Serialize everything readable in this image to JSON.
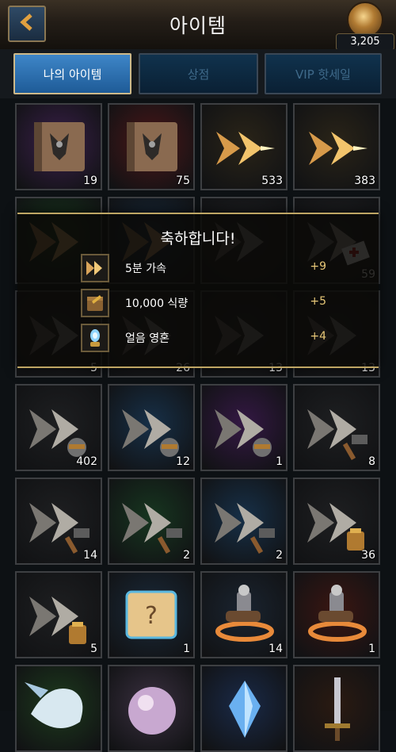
{
  "header": {
    "title": "아이템",
    "power": "3,205"
  },
  "tabs": [
    {
      "label": "나의 아이템",
      "active": true
    },
    {
      "label": "상점",
      "active": false
    },
    {
      "label": "VIP 핫세일",
      "active": false
    }
  ],
  "items": [
    {
      "icon": "dragon-tome-purple",
      "bg": "#3a1f4a",
      "count": "19"
    },
    {
      "icon": "dragon-tome-red",
      "bg": "#4a1618",
      "count": "75"
    },
    {
      "icon": "speedup-gold",
      "bg": "#2a2418",
      "count": "533"
    },
    {
      "icon": "speedup-gold",
      "bg": "#2a2418",
      "count": "383"
    },
    {
      "icon": "speedup-green",
      "bg": "#17361c",
      "count": ""
    },
    {
      "icon": "speedup-blue",
      "bg": "#16283a",
      "count": ""
    },
    {
      "icon": "speedup-dark",
      "bg": "#1e1f21",
      "count": ""
    },
    {
      "icon": "speedup-heal",
      "bg": "#1e1f21",
      "count": "59"
    },
    {
      "icon": "speedup-dark",
      "bg": "#1e1f21",
      "count": "5"
    },
    {
      "icon": "speedup-dark",
      "bg": "#1e1f21",
      "count": "26"
    },
    {
      "icon": "speedup-dark",
      "bg": "#1e1f21",
      "count": "13"
    },
    {
      "icon": "speedup-dark",
      "bg": "#1e1f21",
      "count": "13"
    },
    {
      "icon": "speedup-training",
      "bg": "#1e1f21",
      "count": "402"
    },
    {
      "icon": "speedup-training",
      "bg": "#173048",
      "count": "12"
    },
    {
      "icon": "speedup-training",
      "bg": "#341844",
      "count": "1"
    },
    {
      "icon": "speedup-building",
      "bg": "#1e1f21",
      "count": "8"
    },
    {
      "icon": "speedup-building",
      "bg": "#1e1f21",
      "count": "14"
    },
    {
      "icon": "speedup-building",
      "bg": "#173620",
      "count": "2"
    },
    {
      "icon": "speedup-building",
      "bg": "#173048",
      "count": "2"
    },
    {
      "icon": "speedup-research",
      "bg": "#1e1f21",
      "count": "36"
    },
    {
      "icon": "speedup-research",
      "bg": "#1e1f21",
      "count": "5"
    },
    {
      "icon": "mystery-scroll",
      "bg": "#1a2a3a",
      "count": "1"
    },
    {
      "icon": "cavalry-swap",
      "bg": "#1a2430",
      "count": "14"
    },
    {
      "icon": "cavalry-swap-red",
      "bg": "#3a1612",
      "count": "1"
    },
    {
      "icon": "pegasus",
      "bg": "#1d3a1d",
      "count": ""
    },
    {
      "icon": "orb",
      "bg": "#3a3040",
      "count": ""
    },
    {
      "icon": "crystal",
      "bg": "#1a2a48",
      "count": ""
    },
    {
      "icon": "sword",
      "bg": "#2a1a12",
      "count": ""
    }
  ],
  "popup": {
    "title": "축하합니다!",
    "rewards": [
      {
        "icon": "speedup-icon",
        "name": "5분 가속",
        "amount": "+9"
      },
      {
        "icon": "food-icon",
        "name": "10,000 식량",
        "amount": "+5"
      },
      {
        "icon": "ice-soul-icon",
        "name": "얼음 영혼",
        "amount": "+4"
      }
    ]
  }
}
